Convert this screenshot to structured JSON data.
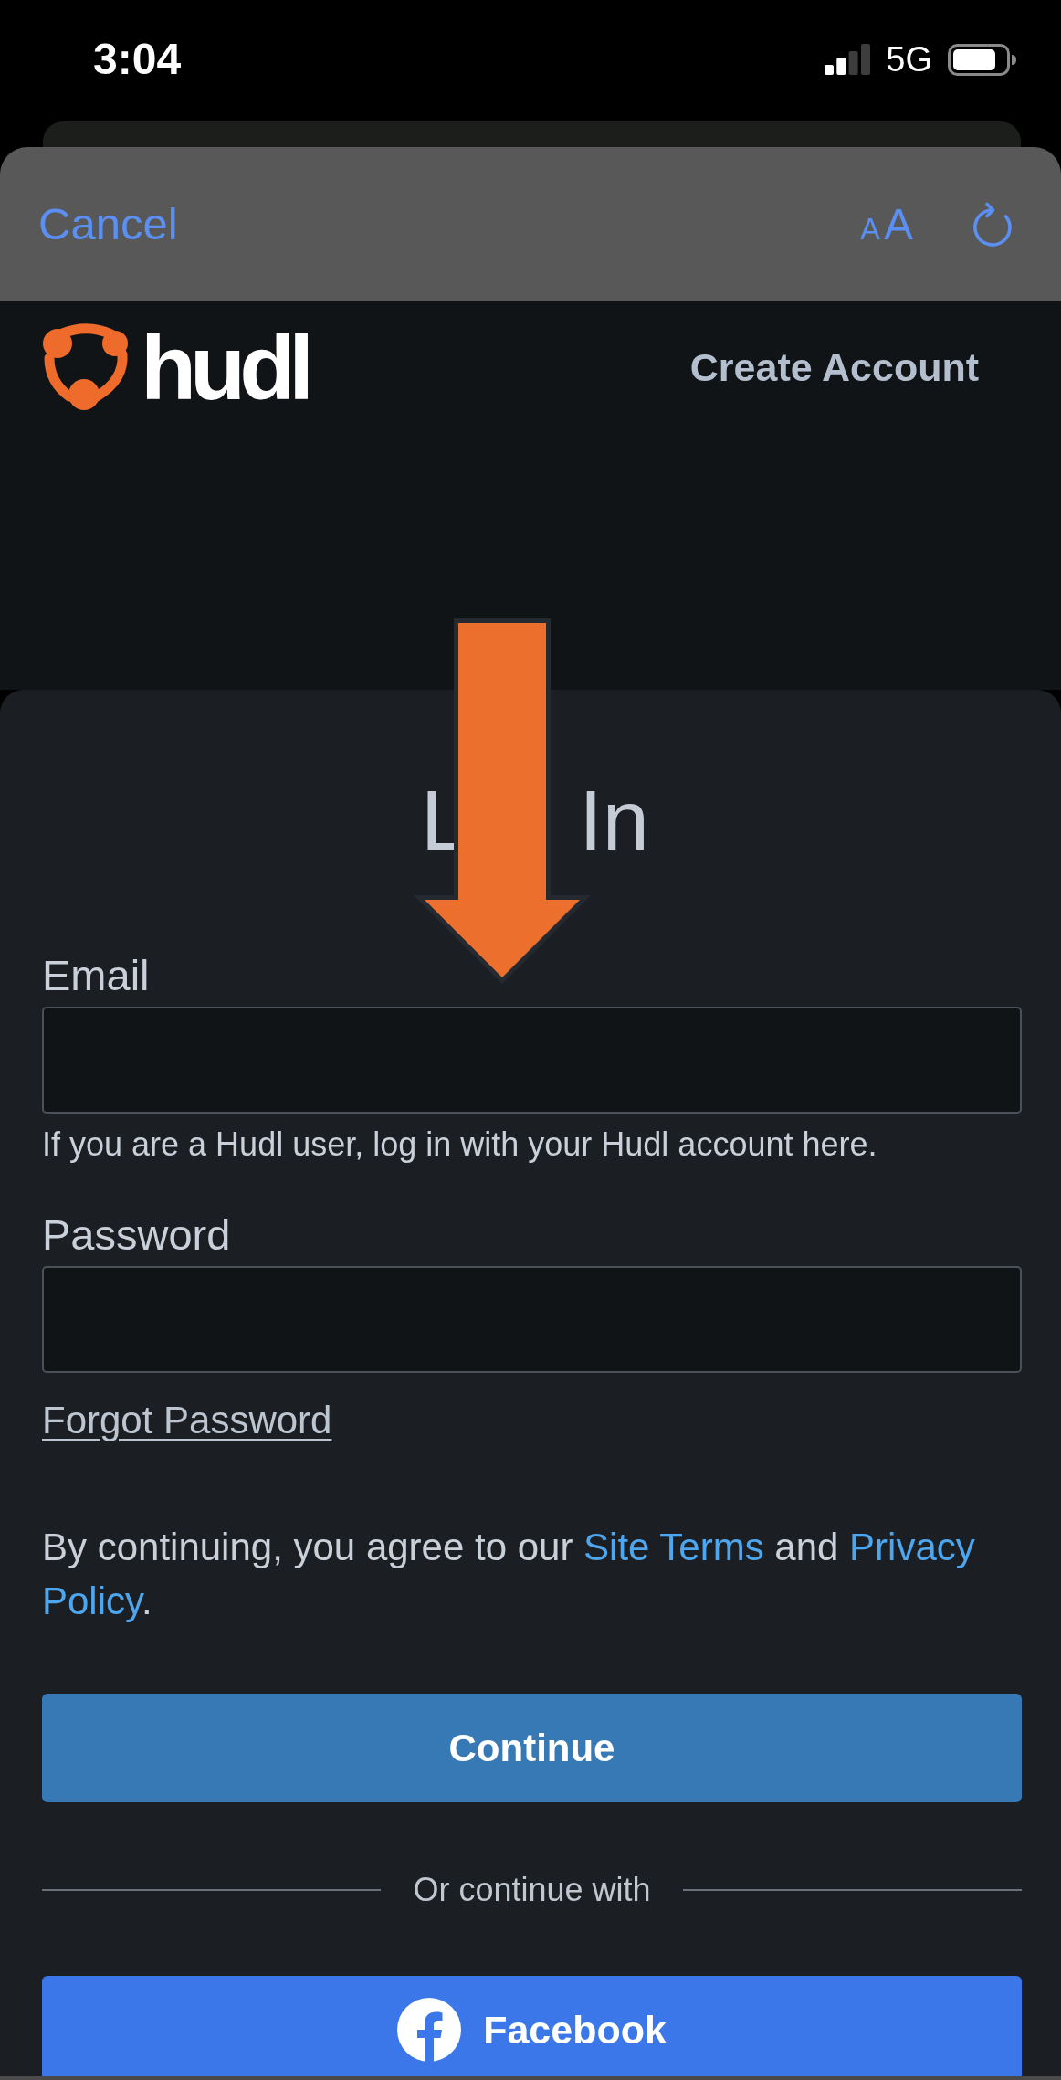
{
  "status_bar": {
    "time": "3:04",
    "network": "5G"
  },
  "sheet_toolbar": {
    "cancel": "Cancel",
    "text_size": {
      "small": "A",
      "large": "A"
    }
  },
  "site_header": {
    "logo_wordmark": "hudl",
    "create_account": "Create Account"
  },
  "login_card": {
    "title_visible": [
      "L",
      "In"
    ],
    "fields": [
      {
        "label": "Email",
        "helper": "If you are a Hudl user, log in with your Hudl account here."
      },
      {
        "label": "Password"
      }
    ],
    "forgot_password": "Forgot Password",
    "terms": [
      {
        "kind": "text",
        "text": "By continuing, you agree to our "
      },
      {
        "kind": "link",
        "parts": [
          "Site Terms"
        ]
      },
      {
        "kind": "text",
        "text": " and "
      },
      {
        "kind": "link",
        "parts": [
          "Privacy",
          "Policy"
        ]
      },
      {
        "kind": "text",
        "text": "."
      }
    ],
    "continue_button": "Continue",
    "divider_text": "Or continue with",
    "social_buttons": [
      {
        "kind": "facebook",
        "label": "Facebook"
      }
    ]
  },
  "annotations": [
    {
      "kind": "arrow"
    }
  ]
}
